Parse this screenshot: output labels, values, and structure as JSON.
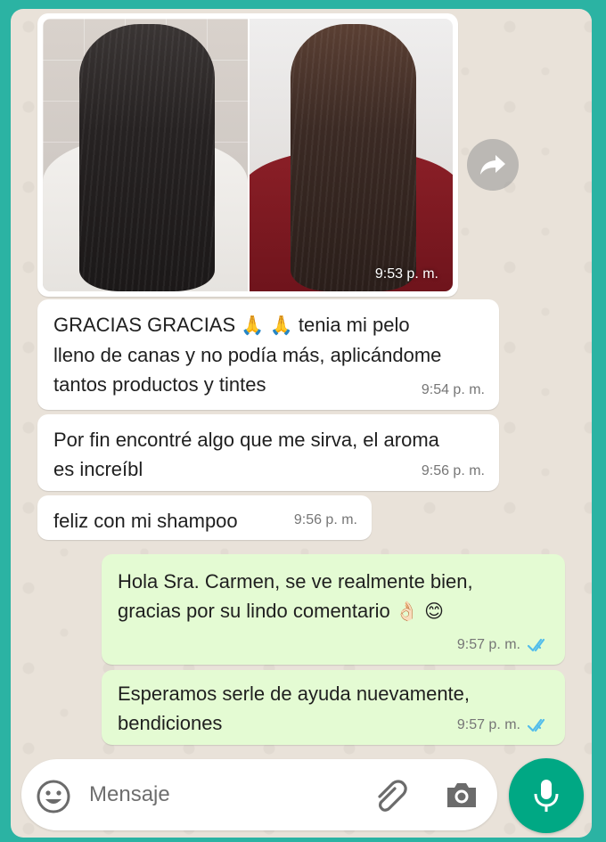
{
  "image_message": {
    "time": "9:53 p. m."
  },
  "messages": [
    {
      "direction": "in",
      "parts": [
        "GRACIAS GRACIAS",
        "tenia mi pelo",
        "lleno de canas y no podía más, aplicándome",
        "tantos productos y tintes"
      ],
      "emoji": "🙏",
      "time": "9:54 p. m."
    },
    {
      "direction": "in",
      "line1": "Por fin encontré algo que me sirva, el aroma",
      "line2": "es increíbl",
      "time": "9:56 p. m."
    },
    {
      "direction": "in",
      "text": "feliz con mi shampoo",
      "time": "9:56 p. m."
    },
    {
      "direction": "out",
      "line1": "Hola Sra. Carmen, se ve realmente bien,",
      "line2": "gracias por su lindo comentario",
      "emoji1": "👌🏻",
      "emoji2": "😊",
      "time": "9:57 p. m.",
      "status": "read"
    },
    {
      "direction": "out",
      "line1": "Esperamos serle de ayuda nuevamente,",
      "line2": "bendiciones",
      "time": "9:57 p. m.",
      "status": "read"
    }
  ],
  "composer": {
    "placeholder": "Mensaje"
  },
  "icons": {
    "forward": "forward-icon",
    "emoji": "emoji-icon",
    "attach": "attach-icon",
    "camera": "camera-icon",
    "mic": "microphone-icon",
    "ticks": "double-check-icon"
  },
  "colors": {
    "frame": "#2bb3a3",
    "wallpaper": "#e9e2d9",
    "incoming_bubble": "#ffffff",
    "outgoing_bubble": "#e4fbd3",
    "read_ticks": "#53bdeb",
    "accent": "#00a884"
  }
}
